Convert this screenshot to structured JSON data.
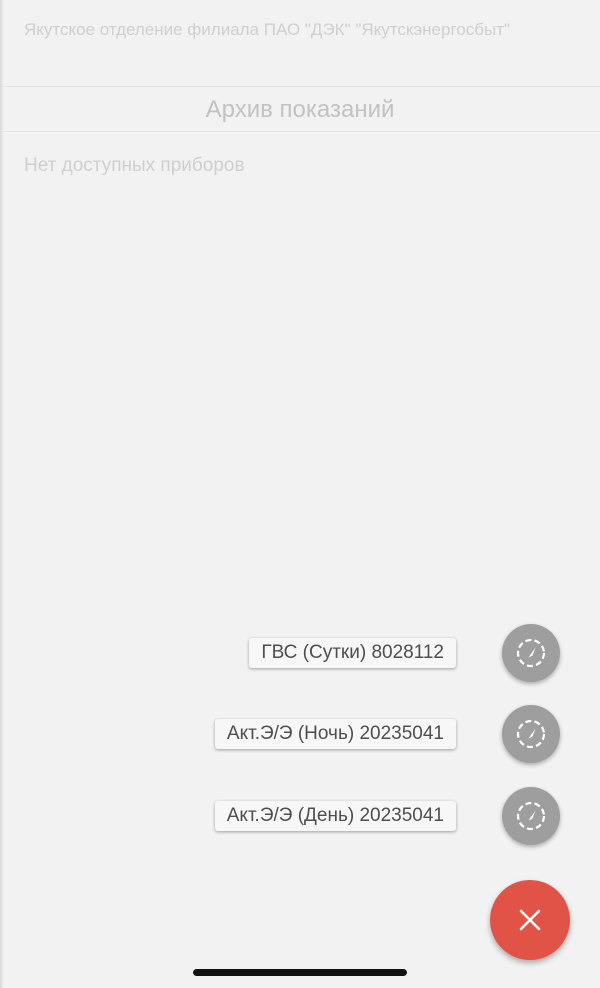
{
  "header": {
    "org_name": "Якутское отделение филиала ПАО \"ДЭК\" \"Якутскэнергосбыт\"",
    "title": "Архив показаний"
  },
  "content": {
    "empty_message": "Нет доступных приборов"
  },
  "fab_menu": {
    "items": [
      {
        "label": "ГВС (Сутки) 8028112",
        "icon": "meter-gauge-icon"
      },
      {
        "label": "Акт.Э/Э (Ночь) 20235041",
        "icon": "meter-gauge-icon"
      },
      {
        "label": "Акт.Э/Э (День) 20235041",
        "icon": "meter-gauge-icon"
      }
    ],
    "close_icon": "close-icon"
  },
  "colors": {
    "background": "#f2f2f2",
    "fab_accent": "#e25347",
    "mini_fab": "#9e9e9e"
  }
}
